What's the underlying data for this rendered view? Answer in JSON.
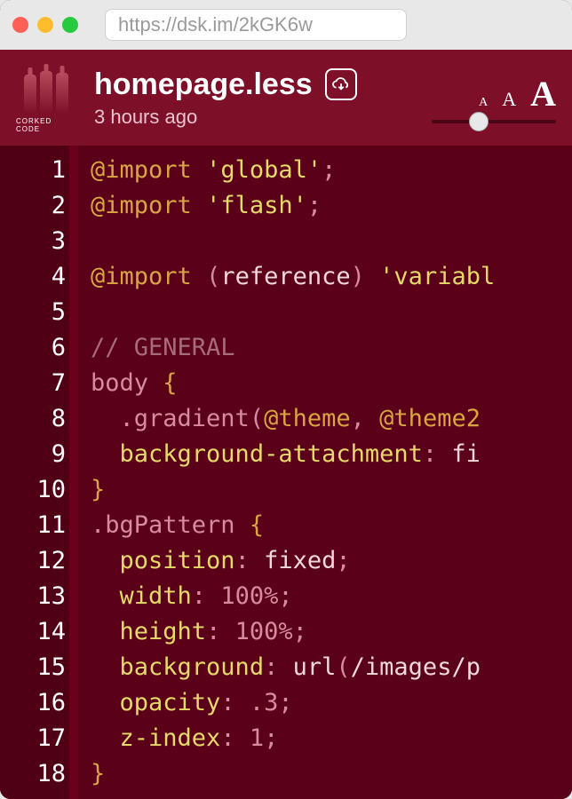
{
  "titlebar": {
    "url": "https://dsk.im/2kGK6w"
  },
  "header": {
    "logo_label": "CORKED CODE",
    "filename": "homepage.less",
    "timestamp": "3 hours ago",
    "font_small": "A",
    "font_medium": "A",
    "font_large": "A"
  },
  "code": {
    "lines": [
      {
        "n": 1,
        "tokens": [
          [
            "kw",
            "@import"
          ],
          [
            "plain",
            " "
          ],
          [
            "str",
            "'global'"
          ],
          [
            "punct",
            ";"
          ]
        ]
      },
      {
        "n": 2,
        "tokens": [
          [
            "kw",
            "@import"
          ],
          [
            "plain",
            " "
          ],
          [
            "str",
            "'flash'"
          ],
          [
            "punct",
            ";"
          ]
        ]
      },
      {
        "n": 3,
        "tokens": []
      },
      {
        "n": 4,
        "tokens": [
          [
            "kw",
            "@import"
          ],
          [
            "plain",
            " "
          ],
          [
            "punct",
            "("
          ],
          [
            "val",
            "reference"
          ],
          [
            "punct",
            ")"
          ],
          [
            "plain",
            " "
          ],
          [
            "str",
            "'variabl"
          ]
        ]
      },
      {
        "n": 5,
        "tokens": []
      },
      {
        "n": 6,
        "tokens": [
          [
            "comment",
            "// GENERAL"
          ]
        ]
      },
      {
        "n": 7,
        "tokens": [
          [
            "selector",
            "body"
          ],
          [
            "plain",
            " "
          ],
          [
            "brace",
            "{"
          ]
        ]
      },
      {
        "n": 8,
        "tokens": [
          [
            "plain",
            "  "
          ],
          [
            "selector",
            ".gradient"
          ],
          [
            "punct",
            "("
          ],
          [
            "kw",
            "@theme"
          ],
          [
            "punct",
            ","
          ],
          [
            "plain",
            " "
          ],
          [
            "kw",
            "@theme2"
          ]
        ]
      },
      {
        "n": 9,
        "tokens": [
          [
            "plain",
            "  "
          ],
          [
            "prop",
            "background-attachment"
          ],
          [
            "colon",
            ":"
          ],
          [
            "plain",
            " "
          ],
          [
            "val",
            "fi"
          ]
        ]
      },
      {
        "n": 10,
        "tokens": [
          [
            "brace",
            "}"
          ]
        ]
      },
      {
        "n": 11,
        "tokens": [
          [
            "selector",
            ".bgPattern"
          ],
          [
            "plain",
            " "
          ],
          [
            "brace",
            "{"
          ]
        ]
      },
      {
        "n": 12,
        "tokens": [
          [
            "plain",
            "  "
          ],
          [
            "prop",
            "position"
          ],
          [
            "colon",
            ":"
          ],
          [
            "plain",
            " "
          ],
          [
            "val",
            "fixed"
          ],
          [
            "punct",
            ";"
          ]
        ]
      },
      {
        "n": 13,
        "tokens": [
          [
            "plain",
            "  "
          ],
          [
            "prop",
            "width"
          ],
          [
            "colon",
            ":"
          ],
          [
            "plain",
            " "
          ],
          [
            "num",
            "100%"
          ],
          [
            "punct",
            ";"
          ]
        ]
      },
      {
        "n": 14,
        "tokens": [
          [
            "plain",
            "  "
          ],
          [
            "prop",
            "height"
          ],
          [
            "colon",
            ":"
          ],
          [
            "plain",
            " "
          ],
          [
            "num",
            "100%"
          ],
          [
            "punct",
            ";"
          ]
        ]
      },
      {
        "n": 15,
        "tokens": [
          [
            "plain",
            "  "
          ],
          [
            "prop",
            "background"
          ],
          [
            "colon",
            ":"
          ],
          [
            "plain",
            " "
          ],
          [
            "url",
            "url"
          ],
          [
            "punct",
            "("
          ],
          [
            "val",
            "/images/p"
          ]
        ]
      },
      {
        "n": 16,
        "tokens": [
          [
            "plain",
            "  "
          ],
          [
            "prop",
            "opacity"
          ],
          [
            "colon",
            ":"
          ],
          [
            "plain",
            " "
          ],
          [
            "num",
            ".3"
          ],
          [
            "punct",
            ";"
          ]
        ]
      },
      {
        "n": 17,
        "tokens": [
          [
            "plain",
            "  "
          ],
          [
            "prop",
            "z-index"
          ],
          [
            "colon",
            ":"
          ],
          [
            "plain",
            " "
          ],
          [
            "num",
            "1"
          ],
          [
            "punct",
            ";"
          ]
        ]
      },
      {
        "n": 18,
        "tokens": [
          [
            "brace",
            "}"
          ]
        ]
      }
    ]
  }
}
